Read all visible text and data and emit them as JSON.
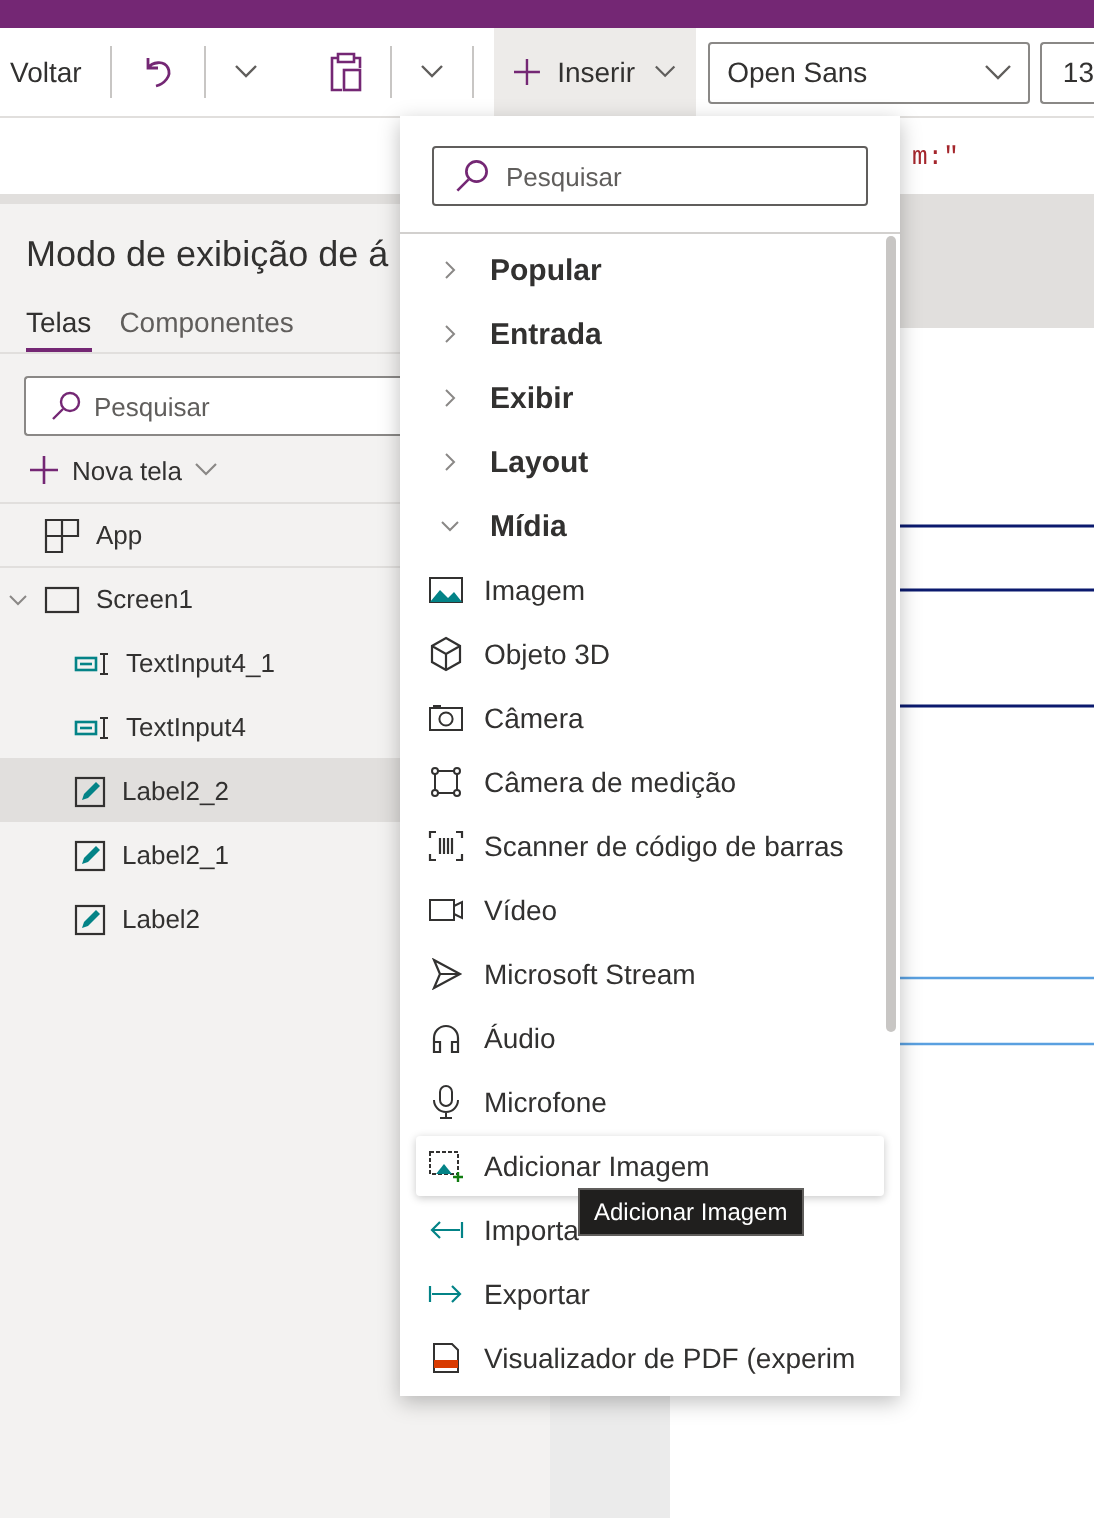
{
  "toolbar": {
    "back_label": "Voltar",
    "insert_button": {
      "label": "Inserir",
      "selected": true
    },
    "font_dropdown": {
      "value": "Open Sans"
    },
    "font_size": {
      "value": "13"
    }
  },
  "formula_bar": {
    "text": "m:\""
  },
  "tree_panel": {
    "title": "Modo de exibição de á",
    "tabs": [
      {
        "label": "Telas",
        "selected": true
      },
      {
        "label": "Componentes",
        "selected": false
      }
    ],
    "search": {
      "placeholder": "Pesquisar"
    },
    "new_screen": "Nova tela",
    "items": [
      {
        "label": "App",
        "kind": "app",
        "selected": false
      },
      {
        "label": "Screen1",
        "kind": "screen",
        "selected": false,
        "expanded": true,
        "children": [
          {
            "label": "TextInput4_1",
            "kind": "textinput",
            "selected": false
          },
          {
            "label": "TextInput4",
            "kind": "textinput",
            "selected": false
          },
          {
            "label": "Label2_2",
            "kind": "label",
            "selected": true
          },
          {
            "label": "Label2_1",
            "kind": "label",
            "selected": false
          },
          {
            "label": "Label2",
            "kind": "label",
            "selected": false
          }
        ]
      }
    ]
  },
  "insert_menu": {
    "search": {
      "placeholder": "Pesquisar"
    },
    "categories": [
      {
        "label": "Popular",
        "expanded": false
      },
      {
        "label": "Entrada",
        "expanded": false
      },
      {
        "label": "Exibir",
        "expanded": false
      },
      {
        "label": "Layout",
        "expanded": false
      },
      {
        "label": "Mídia",
        "expanded": true,
        "children": [
          {
            "label": "Imagem",
            "kind": "image",
            "highlighted": false
          },
          {
            "label": "Objeto 3D",
            "kind": "cube",
            "highlighted": false
          },
          {
            "label": "Câmera",
            "kind": "camera",
            "highlighted": false
          },
          {
            "label": "Câmera de medição",
            "kind": "measure",
            "highlighted": false
          },
          {
            "label": "Scanner de código de barras",
            "kind": "barcode",
            "highlighted": false
          },
          {
            "label": "Vídeo",
            "kind": "video",
            "highlighted": false
          },
          {
            "label": "Microsoft Stream",
            "kind": "stream",
            "highlighted": false
          },
          {
            "label": "Áudio",
            "kind": "audio",
            "highlighted": false
          },
          {
            "label": "Microfone",
            "kind": "mic",
            "highlighted": false
          },
          {
            "label": "Adicionar Imagem",
            "kind": "addimage",
            "highlighted": true
          },
          {
            "label": "Importa",
            "kind": "import",
            "highlighted": false
          },
          {
            "label": "Exportar",
            "kind": "export",
            "highlighted": false
          },
          {
            "label": "Visualizador de PDF (experim",
            "kind": "pdf",
            "highlighted": false
          }
        ]
      }
    ]
  },
  "tooltip": {
    "text": "Adicionar Imagem"
  }
}
